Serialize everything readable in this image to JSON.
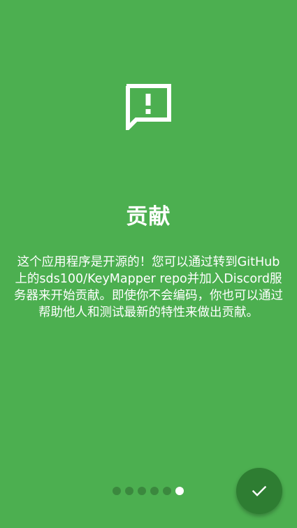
{
  "intro": {
    "title": "贡献",
    "description": "这个应用程序是开源的！您可以通过转到GitHub上的sds100/KeyMapper repo并加入Discord服务器来开始贡献。即使你不会编码，你也可以通过帮助他人和测试最新的特性来做出贡献。",
    "icon": "feedback-icon"
  },
  "pager": {
    "page_count": 6,
    "current_page": 6
  },
  "fab": {
    "icon": "check-icon"
  },
  "colors": {
    "background": "#4CAF50",
    "fab": "#2E7D32",
    "text": "#FFFFFF"
  }
}
